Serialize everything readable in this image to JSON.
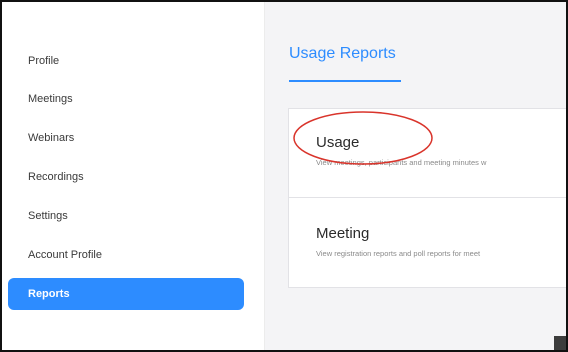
{
  "sidebar": {
    "items": [
      {
        "label": "Profile"
      },
      {
        "label": "Meetings"
      },
      {
        "label": "Webinars"
      },
      {
        "label": "Recordings"
      },
      {
        "label": "Settings"
      },
      {
        "label": "Account Profile"
      },
      {
        "label": "Reports",
        "active": true
      }
    ]
  },
  "main": {
    "title": "Usage Reports",
    "cards": [
      {
        "title": "Usage",
        "description": "View meetings, participants and meeting minutes w"
      },
      {
        "title": "Meeting",
        "description": "View registration reports and poll reports for meet"
      }
    ]
  },
  "annotation": {
    "color": "#d9342b"
  },
  "colors": {
    "accent": "#2d8cff",
    "sidebar_active_text": "#ffffff"
  }
}
